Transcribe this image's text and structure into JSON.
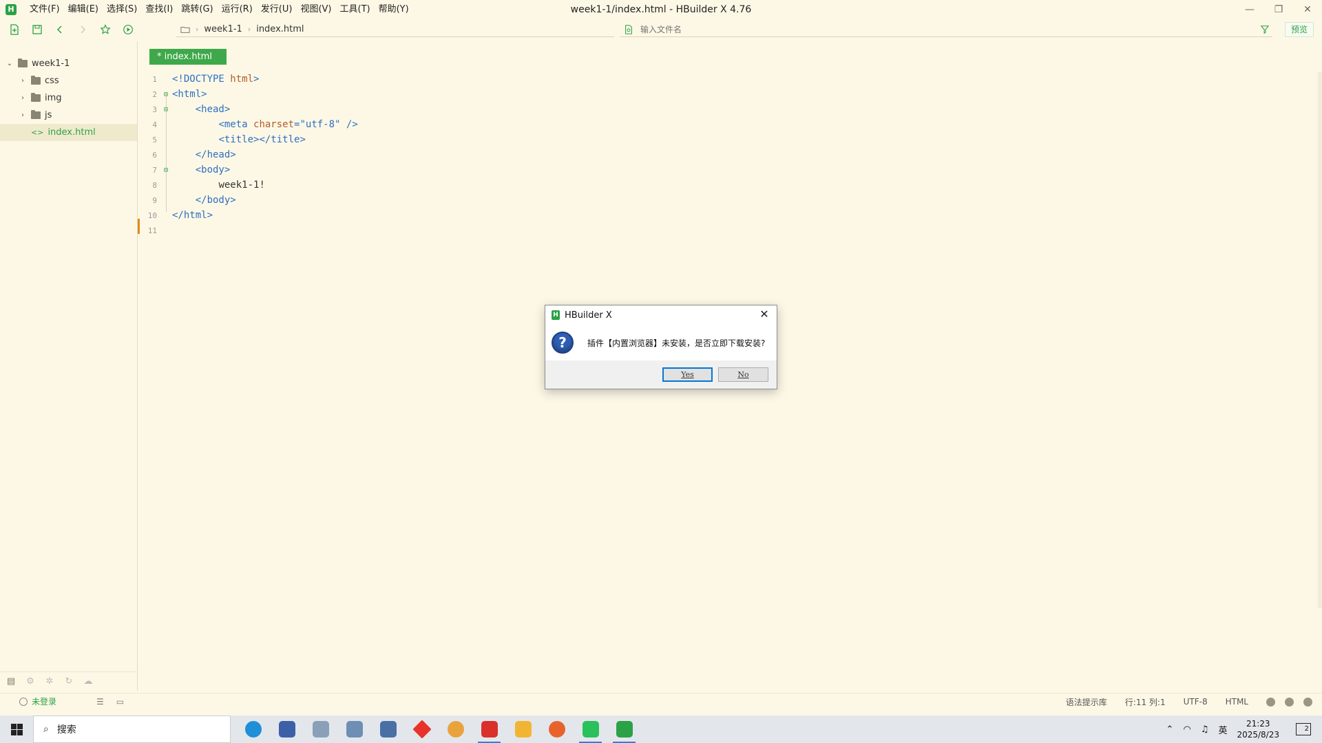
{
  "window": {
    "title": "week1-1/index.html - HBuilder X 4.76",
    "menu": [
      "文件(F)",
      "编辑(E)",
      "选择(S)",
      "查找(I)",
      "跳转(G)",
      "运行(R)",
      "发行(U)",
      "视图(V)",
      "工具(T)",
      "帮助(Y)"
    ],
    "controls": {
      "minimize": "—",
      "restore": "❐",
      "close": "✕"
    }
  },
  "toolbar": {
    "breadcrumb": [
      "week1-1",
      "index.html"
    ],
    "file_search_placeholder": "输入文件名",
    "preview_label": "预览"
  },
  "sidebar": {
    "project": "week1-1",
    "items": [
      {
        "label": "css",
        "type": "folder"
      },
      {
        "label": "img",
        "type": "folder"
      },
      {
        "label": "js",
        "type": "folder"
      },
      {
        "label": "index.html",
        "type": "file"
      }
    ]
  },
  "editor": {
    "tab_label": "* index.html",
    "line_numbers": [
      "1",
      "2",
      "3",
      "4",
      "5",
      "6",
      "7",
      "8",
      "9",
      "10",
      "11"
    ],
    "code": {
      "l1_a": "<!DOCTYPE ",
      "l1_b": "html",
      "l1_c": ">",
      "l2": "<html>",
      "l3": "<head>",
      "l4_a": "<meta ",
      "l4_b": "charset",
      "l4_c": "=",
      "l4_d": "\"utf-8\"",
      "l4_e": " />",
      "l5": "<title></title>",
      "l6": "</head>",
      "l7": "<body>",
      "l8": "week1-1!",
      "l9": "</body>",
      "l10": "</html>"
    }
  },
  "dialog": {
    "title": "HBuilder X",
    "message": "插件【内置浏览器】未安装，是否立即下载安装?",
    "yes_label": "Yes",
    "no_label": "No",
    "close": "✕"
  },
  "statusbar": {
    "login": "未登录",
    "syntax_lib": "语法提示库",
    "position": "行:11  列:1",
    "encoding": "UTF-8",
    "language": "HTML"
  },
  "taskbar": {
    "search_label": "搜索",
    "time": "21:23",
    "date": "2025/8/23",
    "ime": "英",
    "notifications": "2",
    "apps": [
      {
        "name": "edge-icon",
        "color": "#1f8fd8"
      },
      {
        "name": "settings-app-icon",
        "color": "#3c5fa8"
      },
      {
        "name": "photos-icon",
        "color": "#8aa0b8"
      },
      {
        "name": "control-panel-icon",
        "color": "#6f8eb4"
      },
      {
        "name": "network-tool-icon",
        "color": "#4a6fa5"
      },
      {
        "name": "red-diamond-app-icon",
        "color": "#e8332b"
      },
      {
        "name": "chrome-icon",
        "color": "#e8a33d"
      },
      {
        "name": "wps-icon",
        "color": "#d9302b"
      },
      {
        "name": "file-explorer-icon",
        "color": "#f2b533"
      },
      {
        "name": "firefox-icon",
        "color": "#e8632b"
      },
      {
        "name": "wechat-icon",
        "color": "#2ac05a"
      },
      {
        "name": "hbuilder-icon",
        "color": "#2ba245"
      }
    ]
  }
}
